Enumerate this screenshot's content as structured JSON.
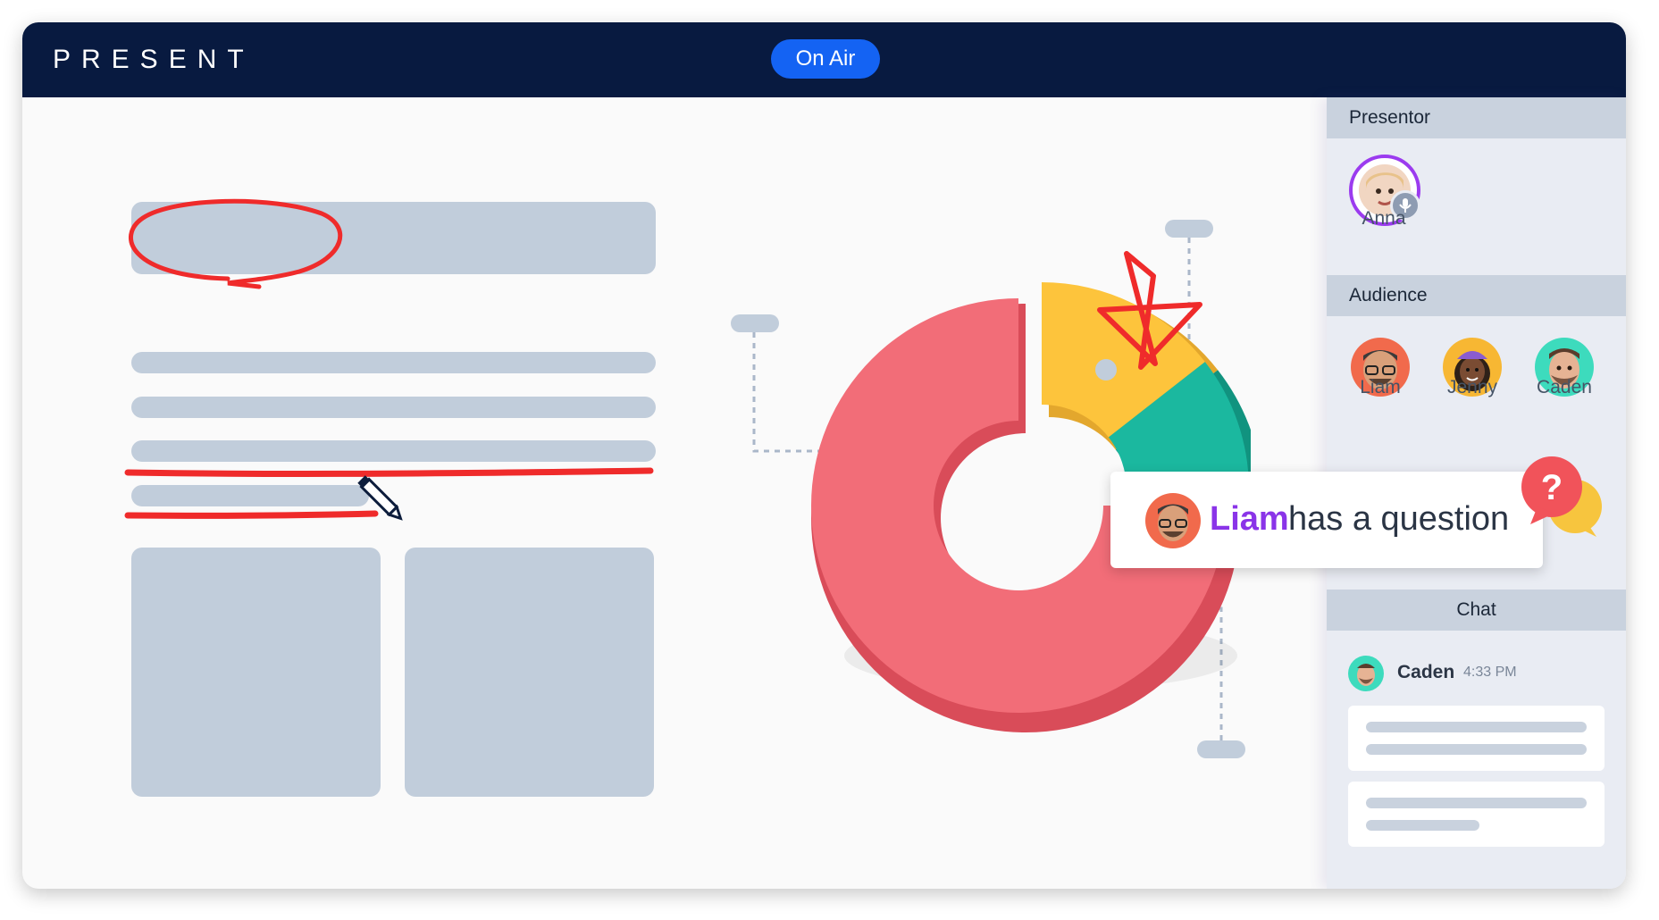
{
  "app": {
    "brand": "PRESENT",
    "status_button": "On Air"
  },
  "sidebar": {
    "presentor_heading": "Presentor",
    "presentor": {
      "name": "Anna",
      "ring_color": "#9b3bef"
    },
    "audience_heading": "Audience",
    "audience": [
      {
        "name": "Liam",
        "color": "#f16a4c"
      },
      {
        "name": "Jenny",
        "color": "#f7b733"
      },
      {
        "name": "Caden",
        "color": "#3ddbbd"
      }
    ],
    "chat_heading": "Chat",
    "chat": {
      "author": "Caden",
      "time": "4:33 PM"
    }
  },
  "notification": {
    "name": "Liam",
    "text": "has a question",
    "badge": "?"
  },
  "chart_data": {
    "type": "pie",
    "title": "",
    "slices": [
      {
        "color": "#f26d78"
      },
      {
        "color": "#fdc43c"
      },
      {
        "color": "#1bb89f"
      }
    ],
    "values_labeled": false
  },
  "colors": {
    "topbar": "#081a40",
    "accent": "#1463f3",
    "annotation": "#ef2b2b",
    "placeholder": "#c1cddb"
  }
}
